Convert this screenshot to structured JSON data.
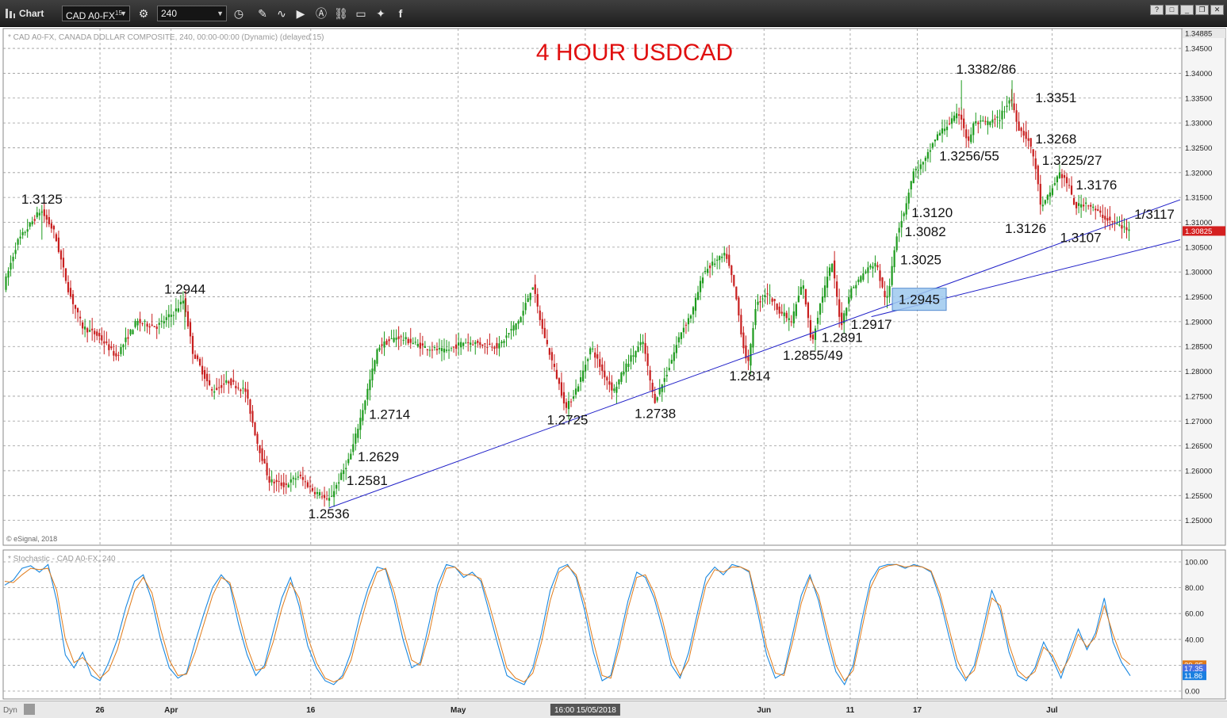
{
  "toolbar": {
    "app_label": "Chart",
    "symbol": "CAD A0-FX",
    "symbol_suffix": "15",
    "interval": "240",
    "icons": [
      "settings-gear-icon",
      "clock-icon",
      "pencil-icon",
      "cursor-wave-icon",
      "play-icon",
      "alert-icon",
      "link-icon",
      "comment-icon",
      "twitter-icon",
      "facebook-icon"
    ],
    "window_buttons": [
      "?",
      "□",
      "_",
      "❐",
      "✕"
    ]
  },
  "chart_data": [
    {
      "type": "candlestick",
      "info_line": "* CAD A0-FX, CANADA DOLLAR COMPOSITE, 240, 00:00-00:00 (Dynamic) (delayed 15)",
      "title": "4 HOUR USDCAD",
      "watermark": "© eSignal, 2018",
      "ylim": [
        1.245,
        1.349
      ],
      "price_ticks": [
        "1.25000",
        "1.25500",
        "1.26000",
        "1.26500",
        "1.27000",
        "1.27500",
        "1.28000",
        "1.28500",
        "1.29000",
        "1.29500",
        "1.30000",
        "1.30500",
        "1.31000",
        "1.31500",
        "1.32000",
        "1.32500",
        "1.33000",
        "1.33500",
        "1.34000",
        "1.34500"
      ],
      "top_value_label": "1.34885",
      "last_price_label": "1.30825",
      "last_price": 1.30825,
      "x_labels": [
        {
          "label": "26",
          "t": 0.0846
        },
        {
          "label": "Apr",
          "t": 0.1478
        },
        {
          "label": "16",
          "t": 0.2719
        },
        {
          "label": "May",
          "t": 0.4029
        },
        {
          "label": "16:00 15/05/2018",
          "t": 0.5158
        },
        {
          "label": "Jun",
          "t": 0.6746
        },
        {
          "label": "11",
          "t": 0.7512
        },
        {
          "label": "17",
          "t": 0.8108
        },
        {
          "label": "Jul",
          "t": 0.9305
        }
      ],
      "path": [
        [
          0.0,
          1.297
        ],
        [
          0.012,
          1.306
        ],
        [
          0.025,
          1.31
        ],
        [
          0.033,
          1.3125
        ],
        [
          0.045,
          1.308
        ],
        [
          0.058,
          1.296
        ],
        [
          0.07,
          1.289
        ],
        [
          0.085,
          1.287
        ],
        [
          0.1,
          1.283
        ],
        [
          0.118,
          1.29
        ],
        [
          0.136,
          1.289
        ],
        [
          0.152,
          1.292
        ],
        [
          0.16,
          1.2944
        ],
        [
          0.168,
          1.284
        ],
        [
          0.185,
          1.276
        ],
        [
          0.2,
          1.278
        ],
        [
          0.215,
          1.276
        ],
        [
          0.225,
          1.266
        ],
        [
          0.236,
          1.258
        ],
        [
          0.25,
          1.257
        ],
        [
          0.262,
          1.259
        ],
        [
          0.275,
          1.256
        ],
        [
          0.283,
          1.255
        ],
        [
          0.288,
          1.2536
        ],
        [
          0.298,
          1.2581
        ],
        [
          0.308,
          1.2629
        ],
        [
          0.318,
          1.2714
        ],
        [
          0.333,
          1.285
        ],
        [
          0.35,
          1.287
        ],
        [
          0.372,
          1.285
        ],
        [
          0.392,
          1.284
        ],
        [
          0.41,
          1.286
        ],
        [
          0.44,
          1.285
        ],
        [
          0.46,
          1.291
        ],
        [
          0.47,
          1.2975
        ],
        [
          0.478,
          1.289
        ],
        [
          0.49,
          1.28
        ],
        [
          0.5,
          1.2725
        ],
        [
          0.512,
          1.278
        ],
        [
          0.522,
          1.285
        ],
        [
          0.532,
          1.28
        ],
        [
          0.542,
          1.276
        ],
        [
          0.555,
          1.282
        ],
        [
          0.568,
          1.286
        ],
        [
          0.578,
          1.2738
        ],
        [
          0.59,
          1.28
        ],
        [
          0.602,
          1.288
        ],
        [
          0.612,
          1.292
        ],
        [
          0.622,
          1.3
        ],
        [
          0.632,
          1.302
        ],
        [
          0.642,
          1.3035
        ],
        [
          0.65,
          1.296
        ],
        [
          0.658,
          1.284
        ],
        [
          0.662,
          1.2814
        ],
        [
          0.668,
          1.293
        ],
        [
          0.678,
          1.296
        ],
        [
          0.69,
          1.292
        ],
        [
          0.7,
          1.29
        ],
        [
          0.71,
          1.298
        ],
        [
          0.718,
          1.2855
        ],
        [
          0.726,
          1.294
        ],
        [
          0.736,
          1.302
        ],
        [
          0.744,
          1.2891
        ],
        [
          0.752,
          1.296
        ],
        [
          0.765,
          1.3
        ],
        [
          0.775,
          1.302
        ],
        [
          0.782,
          1.2955
        ],
        [
          0.786,
          1.2945
        ],
        [
          0.79,
          1.3025
        ],
        [
          0.794,
          1.3082
        ],
        [
          0.8,
          1.312
        ],
        [
          0.808,
          1.32
        ],
        [
          0.818,
          1.322
        ],
        [
          0.828,
          1.327
        ],
        [
          0.84,
          1.33
        ],
        [
          0.85,
          1.332
        ],
        [
          0.857,
          1.3256
        ],
        [
          0.862,
          1.33
        ],
        [
          0.875,
          1.33
        ],
        [
          0.885,
          1.331
        ],
        [
          0.895,
          1.3351
        ],
        [
          0.902,
          1.329
        ],
        [
          0.91,
          1.3268
        ],
        [
          0.916,
          1.3225
        ],
        [
          0.922,
          1.3126
        ],
        [
          0.93,
          1.316
        ],
        [
          0.938,
          1.32
        ],
        [
          0.946,
          1.3176
        ],
        [
          0.952,
          1.313
        ],
        [
          0.962,
          1.314
        ],
        [
          0.972,
          1.312
        ],
        [
          0.98,
          1.3107
        ],
        [
          0.99,
          1.3095
        ],
        [
          1.0,
          1.30825
        ]
      ],
      "highs": [
        {
          "t": 0.033,
          "p": 1.3125
        },
        {
          "t": 0.16,
          "p": 1.2944
        },
        {
          "t": 0.85,
          "p": 1.3386
        },
        {
          "t": 0.895,
          "p": 1.3386
        }
      ],
      "annotations": [
        {
          "label": "1.3125",
          "t": 0.033,
          "p": 1.3125,
          "pos": "above"
        },
        {
          "label": "1.2944",
          "t": 0.16,
          "p": 1.2944,
          "pos": "above"
        },
        {
          "label": "1.2536",
          "t": 0.288,
          "p": 1.2536,
          "pos": "below"
        },
        {
          "label": "1.2581",
          "t": 0.298,
          "p": 1.2581,
          "pos": "right"
        },
        {
          "label": "1.2629",
          "t": 0.308,
          "p": 1.2629,
          "pos": "right"
        },
        {
          "label": "1.2714",
          "t": 0.318,
          "p": 1.2714,
          "pos": "right"
        },
        {
          "label": "1.2725",
          "t": 0.5,
          "p": 1.2725,
          "pos": "below"
        },
        {
          "label": "1.2738",
          "t": 0.578,
          "p": 1.2738,
          "pos": "below"
        },
        {
          "label": "1.2814",
          "t": 0.662,
          "p": 1.2814,
          "pos": "below"
        },
        {
          "label": "1.2855/49",
          "t": 0.718,
          "p": 1.2855,
          "pos": "below"
        },
        {
          "label": "1.2891",
          "t": 0.744,
          "p": 1.2891,
          "pos": "below"
        },
        {
          "label": "1.2917",
          "t": 0.77,
          "p": 1.2917,
          "pos": "below"
        },
        {
          "label": "1.3025",
          "t": 0.79,
          "p": 1.3025,
          "pos": "right"
        },
        {
          "label": "1.3082",
          "t": 0.794,
          "p": 1.3082,
          "pos": "right"
        },
        {
          "label": "1.3120",
          "t": 0.8,
          "p": 1.312,
          "pos": "right"
        },
        {
          "label": "1.3382/86",
          "t": 0.872,
          "p": 1.3386,
          "pos": "above"
        },
        {
          "label": "1.3351",
          "t": 0.91,
          "p": 1.3351,
          "pos": "right"
        },
        {
          "label": "1.3256/55",
          "t": 0.857,
          "p": 1.3256,
          "pos": "below"
        },
        {
          "label": "1.3268",
          "t": 0.91,
          "p": 1.3268,
          "pos": "right"
        },
        {
          "label": "1.3225/27",
          "t": 0.916,
          "p": 1.3225,
          "pos": "right"
        },
        {
          "label": "1.3176",
          "t": 0.946,
          "p": 1.3176,
          "pos": "right"
        },
        {
          "label": "1.3126",
          "t": 0.907,
          "p": 1.311,
          "pos": "below"
        },
        {
          "label": "1.3107",
          "t": 0.956,
          "p": 1.3092,
          "pos": "below"
        },
        {
          "label": "1/3117",
          "t": 0.998,
          "p": 1.3117,
          "pos": "right"
        }
      ],
      "highlight_box": {
        "label": "1.2945",
        "p": 1.2945
      },
      "trendlines": [
        {
          "t1": 0.288,
          "p1": 1.2525,
          "t2": 1.05,
          "p2": 1.315
        },
        {
          "t1": 0.77,
          "p1": 1.291,
          "t2": 1.05,
          "p2": 1.3068
        }
      ]
    },
    {
      "type": "line",
      "info_line": "* Stochastic - CAD A0-FX, 240",
      "ylim": [
        0,
        100
      ],
      "ticks": [
        "0.00",
        "20.00",
        "40.00",
        "60.00",
        "80.00",
        "100.00"
      ],
      "value_labels": [
        {
          "label": "20.35",
          "value": 20.35,
          "color": "#e07b1a"
        },
        {
          "label": "17.35",
          "value": 17.35,
          "color": "#4a6fe3"
        },
        {
          "label": "11.86",
          "value": 11.86,
          "color": "#1a7fe0"
        }
      ],
      "series": [
        {
          "color": "#1a88e0",
          "values": [
            82,
            86,
            95,
            97,
            92,
            98,
            70,
            28,
            18,
            30,
            12,
            8,
            22,
            40,
            65,
            85,
            90,
            70,
            40,
            18,
            10,
            14,
            38,
            60,
            80,
            90,
            82,
            52,
            28,
            12,
            20,
            46,
            72,
            88,
            66,
            35,
            18,
            8,
            5,
            12,
            30,
            58,
            80,
            96,
            94,
            70,
            40,
            18,
            22,
            52,
            82,
            98,
            96,
            88,
            92,
            85,
            60,
            35,
            12,
            8,
            5,
            18,
            45,
            78,
            95,
            98,
            88,
            62,
            30,
            8,
            12,
            40,
            70,
            92,
            88,
            72,
            48,
            20,
            10,
            30,
            60,
            88,
            96,
            90,
            98,
            96,
            92,
            60,
            28,
            10,
            14,
            44,
            74,
            90,
            70,
            40,
            15,
            5,
            20,
            55,
            85,
            96,
            98,
            98,
            95,
            98,
            96,
            92,
            72,
            44,
            18,
            8,
            20,
            48,
            78,
            62,
            30,
            12,
            8,
            18,
            38,
            25,
            10,
            30,
            48,
            32,
            45,
            72,
            38,
            22,
            11.86
          ]
        },
        {
          "color": "#e07b1a",
          "values": [
            85,
            84,
            90,
            95,
            94,
            95,
            78,
            40,
            22,
            26,
            18,
            10,
            16,
            32,
            56,
            78,
            88,
            76,
            48,
            24,
            12,
            13,
            30,
            52,
            74,
            88,
            84,
            60,
            34,
            16,
            18,
            38,
            64,
            84,
            72,
            42,
            22,
            10,
            7,
            10,
            24,
            50,
            74,
            92,
            95,
            76,
            48,
            24,
            20,
            44,
            76,
            95,
            96,
            90,
            90,
            87,
            66,
            42,
            18,
            10,
            7,
            14,
            38,
            70,
            92,
            97,
            90,
            68,
            38,
            12,
            10,
            34,
            64,
            88,
            90,
            76,
            54,
            26,
            12,
            24,
            54,
            82,
            94,
            92,
            96,
            96,
            93,
            66,
            34,
            14,
            12,
            38,
            68,
            88,
            74,
            46,
            20,
            8,
            16,
            48,
            80,
            94,
            97,
            98,
            96,
            97,
            96,
            93,
            76,
            50,
            24,
            10,
            16,
            42,
            72,
            66,
            36,
            16,
            10,
            15,
            34,
            28,
            14,
            26,
            44,
            34,
            42,
            66,
            44,
            26,
            20.35
          ]
        }
      ]
    }
  ]
}
